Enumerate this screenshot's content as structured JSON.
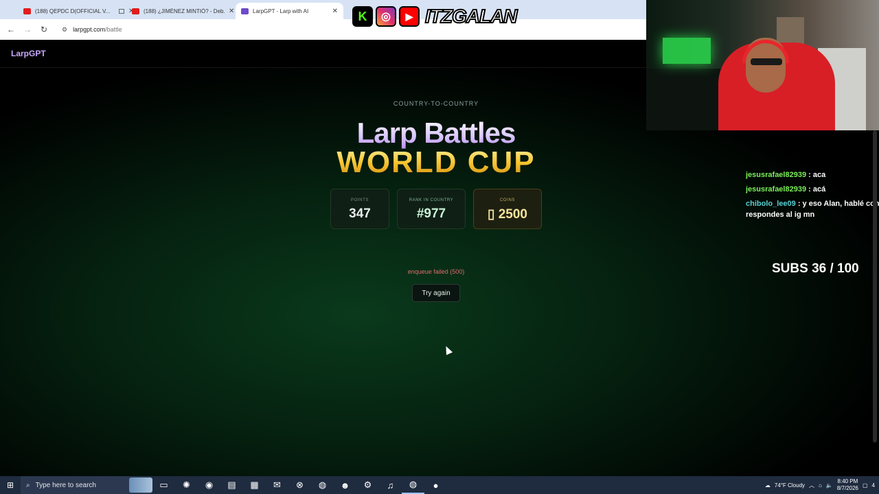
{
  "browser": {
    "tabs": [
      {
        "label": "(188) QEPDC D(OFFICIAL V...",
        "favicon": "youtube-icon"
      },
      {
        "label": "(188) ¿JIMÉNEZ MINTIÓ? - Deb...",
        "favicon": "youtube-icon"
      },
      {
        "label": "LarpGPT - Larp with AI",
        "favicon": "larpgpt-icon",
        "active": true
      }
    ],
    "url_domain": "larpgpt.com",
    "url_path": "/battle"
  },
  "overlay": {
    "handle": "ITZGALAN",
    "social_icons": [
      "kick-icon",
      "instagram-icon",
      "youtube-icon"
    ]
  },
  "page": {
    "brand": "LarpGPT",
    "eyebrow": "COUNTRY-TO-COUNTRY",
    "title": "Larp Battles",
    "subtitle": "WORLD CUP",
    "stats": {
      "points_label": "POINTS",
      "points_value": "347",
      "rank_label": "RANK IN COUNTRY",
      "rank_value": "#977",
      "coins_label": "COINS",
      "coins_value": "▯ 2500"
    },
    "error_text": "enqueue failed (500)",
    "retry_label": "Try again"
  },
  "chat": {
    "messages": [
      {
        "user": "jesusrafael82939",
        "text": " : aca"
      },
      {
        "user": "jesusrafael82939",
        "text": " : acá"
      },
      {
        "user": "chibolo_lee09",
        "text": " : y eso Alan, hablé con",
        "cont": "respondes al ig mn"
      }
    ],
    "subs": "SUBS 36 / 100"
  },
  "taskbar": {
    "search_placeholder": "Type here to search",
    "weather": "74°F  Cloudy",
    "time": "8:40 PM",
    "date": "8/7/2026",
    "notifications": "4"
  },
  "colors": {
    "brand": "#c9a8ff",
    "title_gold": "#f7c531",
    "error": "#e06a6a",
    "chat_user_green": "#7cf05a",
    "chat_user_cyan": "#58d1d4"
  }
}
